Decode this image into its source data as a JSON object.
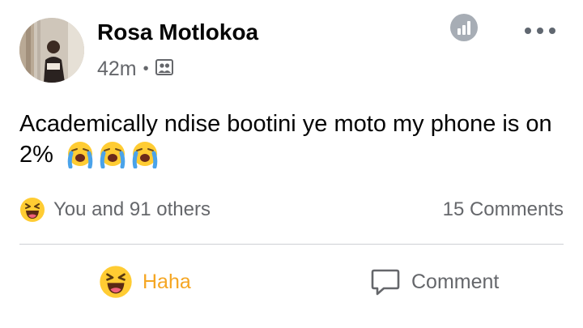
{
  "post": {
    "author": "Rosa Motlokoa",
    "time": "42m",
    "separator": "•",
    "audience_icon": "friends-icon",
    "text": "Academically ndise bootini ye moto my phone is on 2%",
    "emojis": [
      "loudly-crying-face",
      "loudly-crying-face",
      "loudly-crying-face"
    ]
  },
  "reactions": {
    "icon": "haha-emoji",
    "summary": "You and 91 others"
  },
  "comments": {
    "count_label": "15 Comments"
  },
  "actions": {
    "reaction_label": "Haha",
    "comment_label": "Comment"
  },
  "colors": {
    "text": "#050505",
    "secondary": "#65676b",
    "haha": "#f5a623",
    "divider": "#ced0d4"
  }
}
